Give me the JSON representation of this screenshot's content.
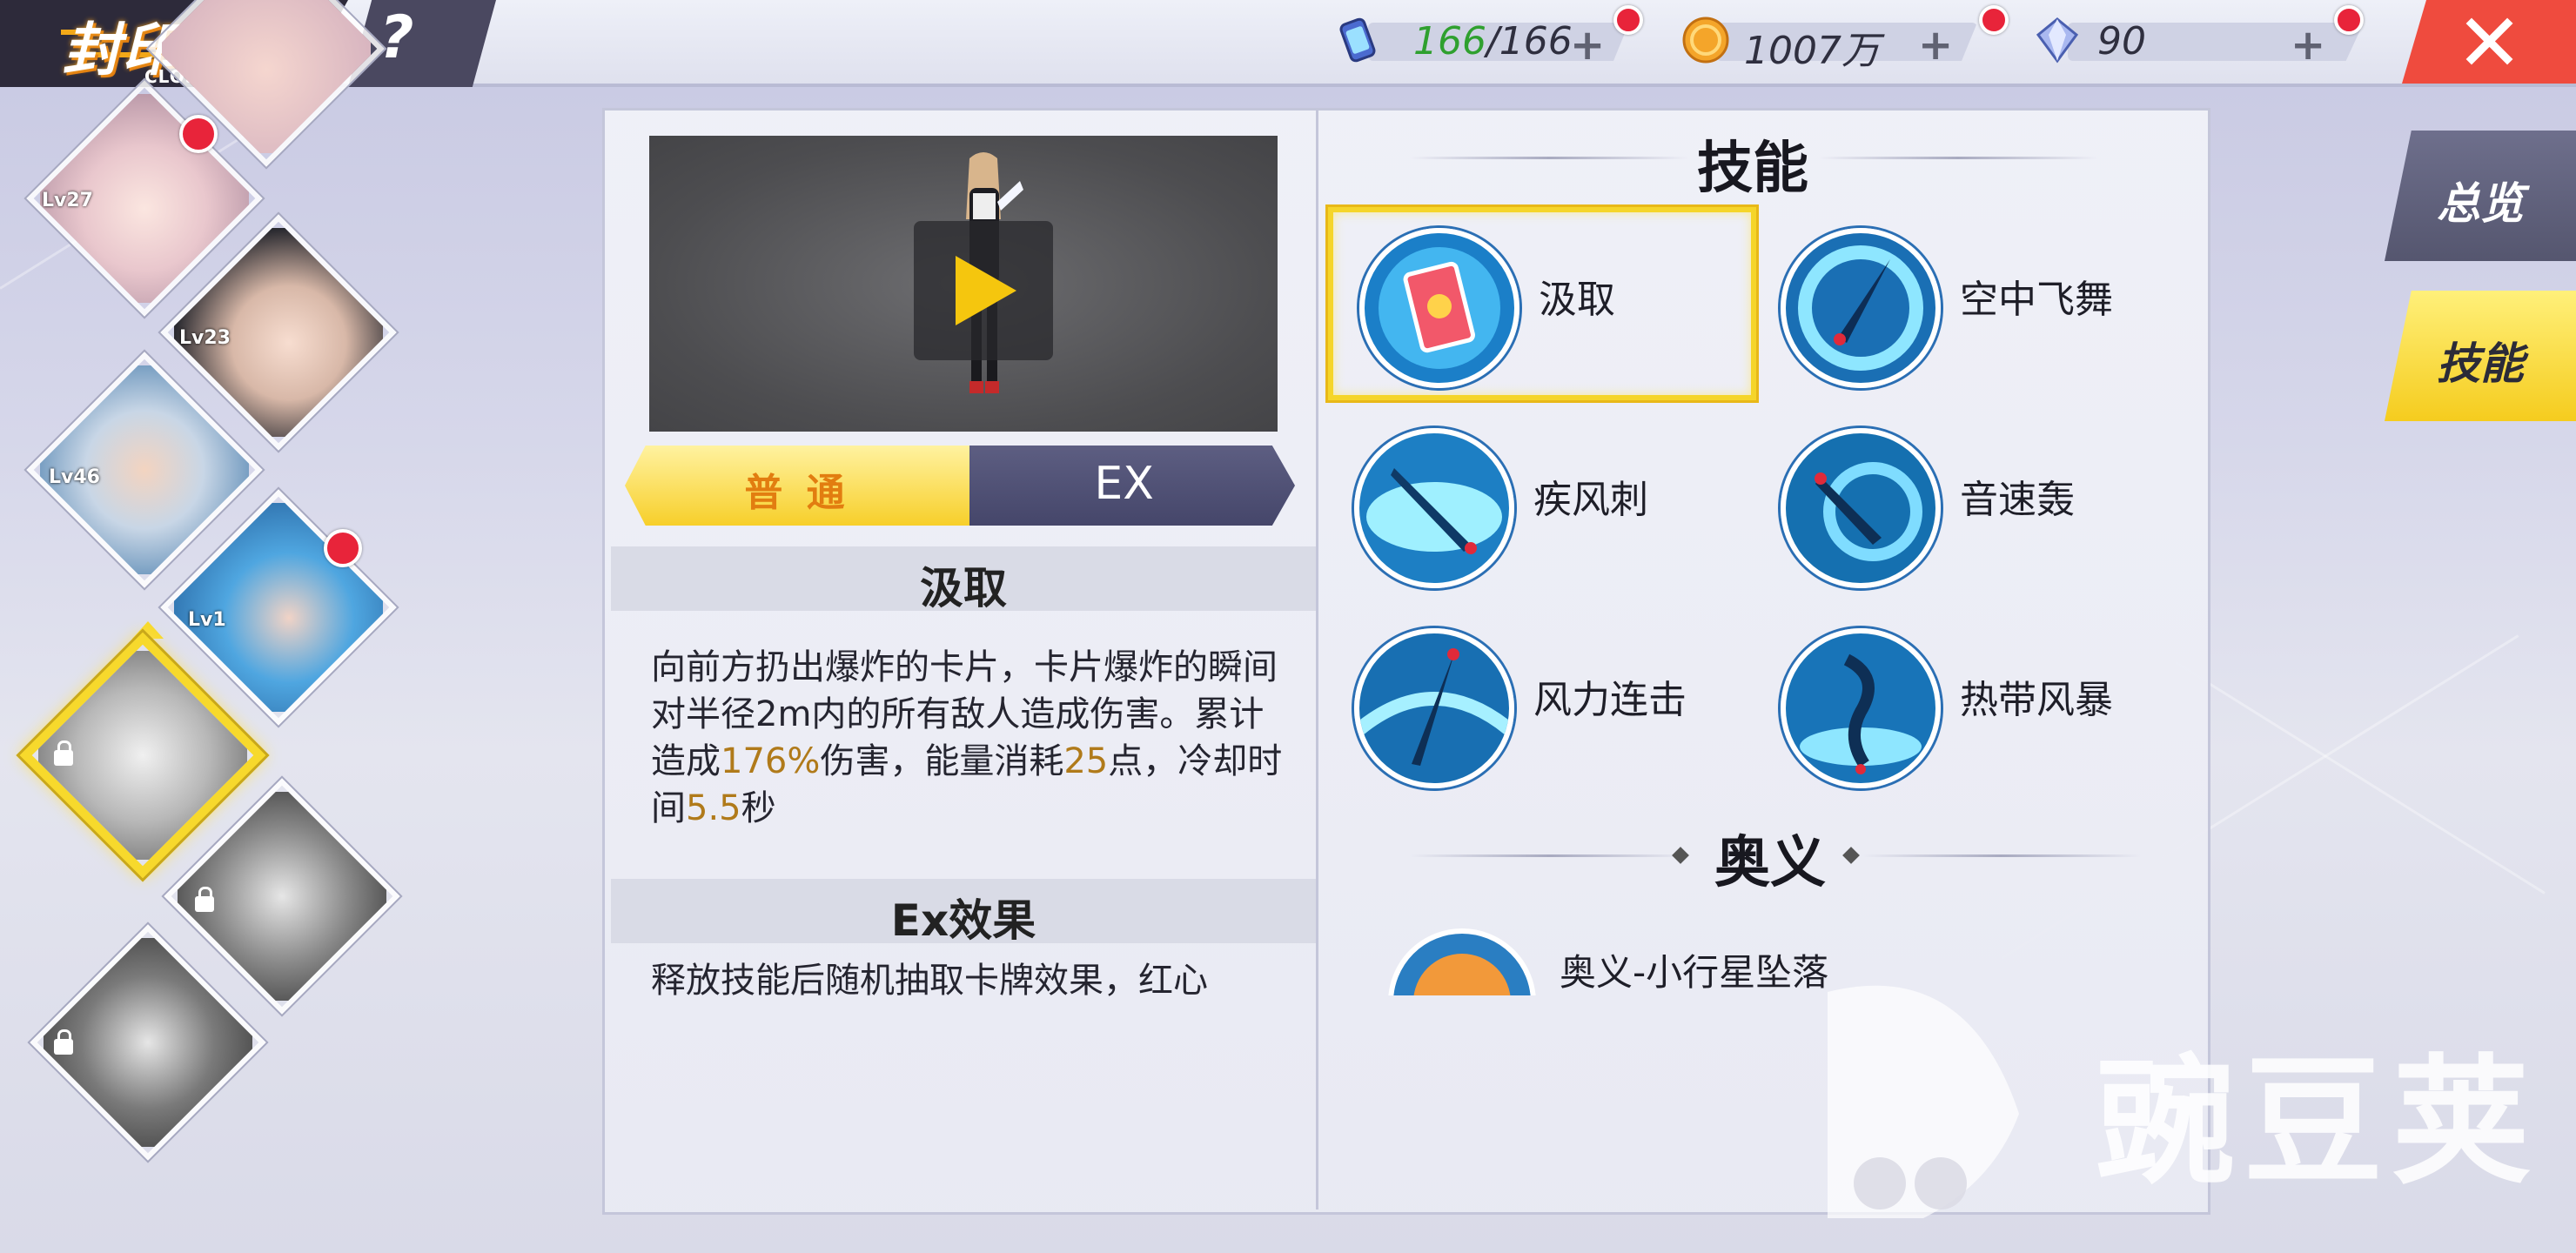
{
  "header": {
    "logo_title": "封印者",
    "logo_subtitle": "CLOSER",
    "help_label": "?",
    "close_label": "✕"
  },
  "resources": {
    "stamina": {
      "current": "166",
      "max": "/166",
      "icon": "stamina-canister-icon"
    },
    "gold": {
      "value": "1007万",
      "icon": "gold-coin-icon"
    },
    "diamonds": {
      "value": "90",
      "icon": "diamond-icon"
    },
    "plus_label": "+"
  },
  "characters": [
    {
      "level": "Lv27",
      "locked": false,
      "alert": true
    },
    {
      "level": "Lv23",
      "locked": false,
      "alert": false
    },
    {
      "level": "Lv46",
      "locked": false,
      "alert": false
    },
    {
      "level": "Lv1",
      "locked": false,
      "alert": true
    },
    {
      "level": "",
      "locked": true,
      "selected": true
    },
    {
      "level": "",
      "locked": true
    },
    {
      "level": "",
      "locked": true
    }
  ],
  "detail": {
    "tabs": {
      "normal": "普 通",
      "ex": "EX"
    },
    "skill_title": "汲取",
    "desc_parts": [
      "向前方扔出爆炸的卡片，卡片爆炸的瞬间对半径2m内的所有敌人造成伤害。累计造成",
      "176%",
      "伤害，能量消耗",
      "25",
      "点，冷却时间",
      "5.5",
      "秒"
    ],
    "ex_title": "Ex效果",
    "ex_desc": "释放技能后随机抽取卡牌效果，红心"
  },
  "skills_panel": {
    "title": "技能",
    "skills": [
      {
        "name": "汲取",
        "icon": "card-skill-icon",
        "selected": true
      },
      {
        "name": "空中飞舞",
        "icon": "air-dance-icon"
      },
      {
        "name": "疾风刺",
        "icon": "gale-thrust-icon"
      },
      {
        "name": "音速轰",
        "icon": "sonic-boom-icon"
      },
      {
        "name": "风力连击",
        "icon": "wind-combo-icon"
      },
      {
        "name": "热带风暴",
        "icon": "tropical-storm-icon"
      }
    ],
    "ultimate_title": "奥义",
    "ultimate_skill": {
      "name": "奥义-小行星坠落",
      "icon": "asteroid-icon"
    }
  },
  "side_tabs": {
    "overview": "总览",
    "skills": "技能"
  },
  "watermark": {
    "text": "豌豆荚"
  },
  "colors": {
    "accent": "#f7d92c",
    "close": "#ef4b3e",
    "alert": "#e8243a",
    "tab_ex": "#4f5075"
  }
}
